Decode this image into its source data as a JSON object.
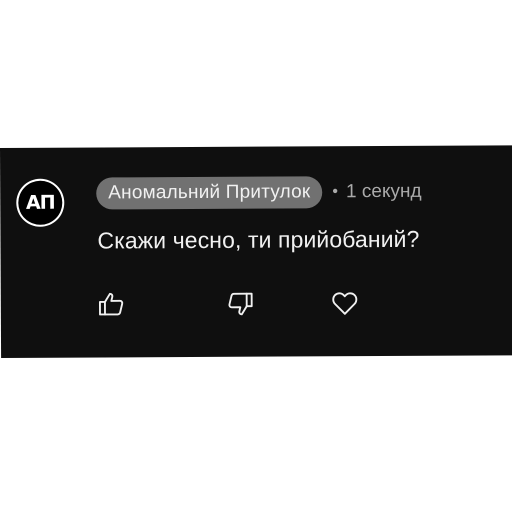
{
  "comment": {
    "author": {
      "name": "Аномальний Притулок",
      "avatar_initials": "АП"
    },
    "separator": "•",
    "timestamp": "1 секунд",
    "text": "Скажи чесно, ти прийобаний?"
  },
  "actions": {
    "like_icon": "thumbs-up-icon",
    "dislike_icon": "thumbs-down-icon",
    "heart_icon": "heart-icon"
  },
  "colors": {
    "background": "#0f0f0f",
    "author_chip": "#717171",
    "text": "#f1f1f1",
    "muted": "#aaaaaa"
  }
}
